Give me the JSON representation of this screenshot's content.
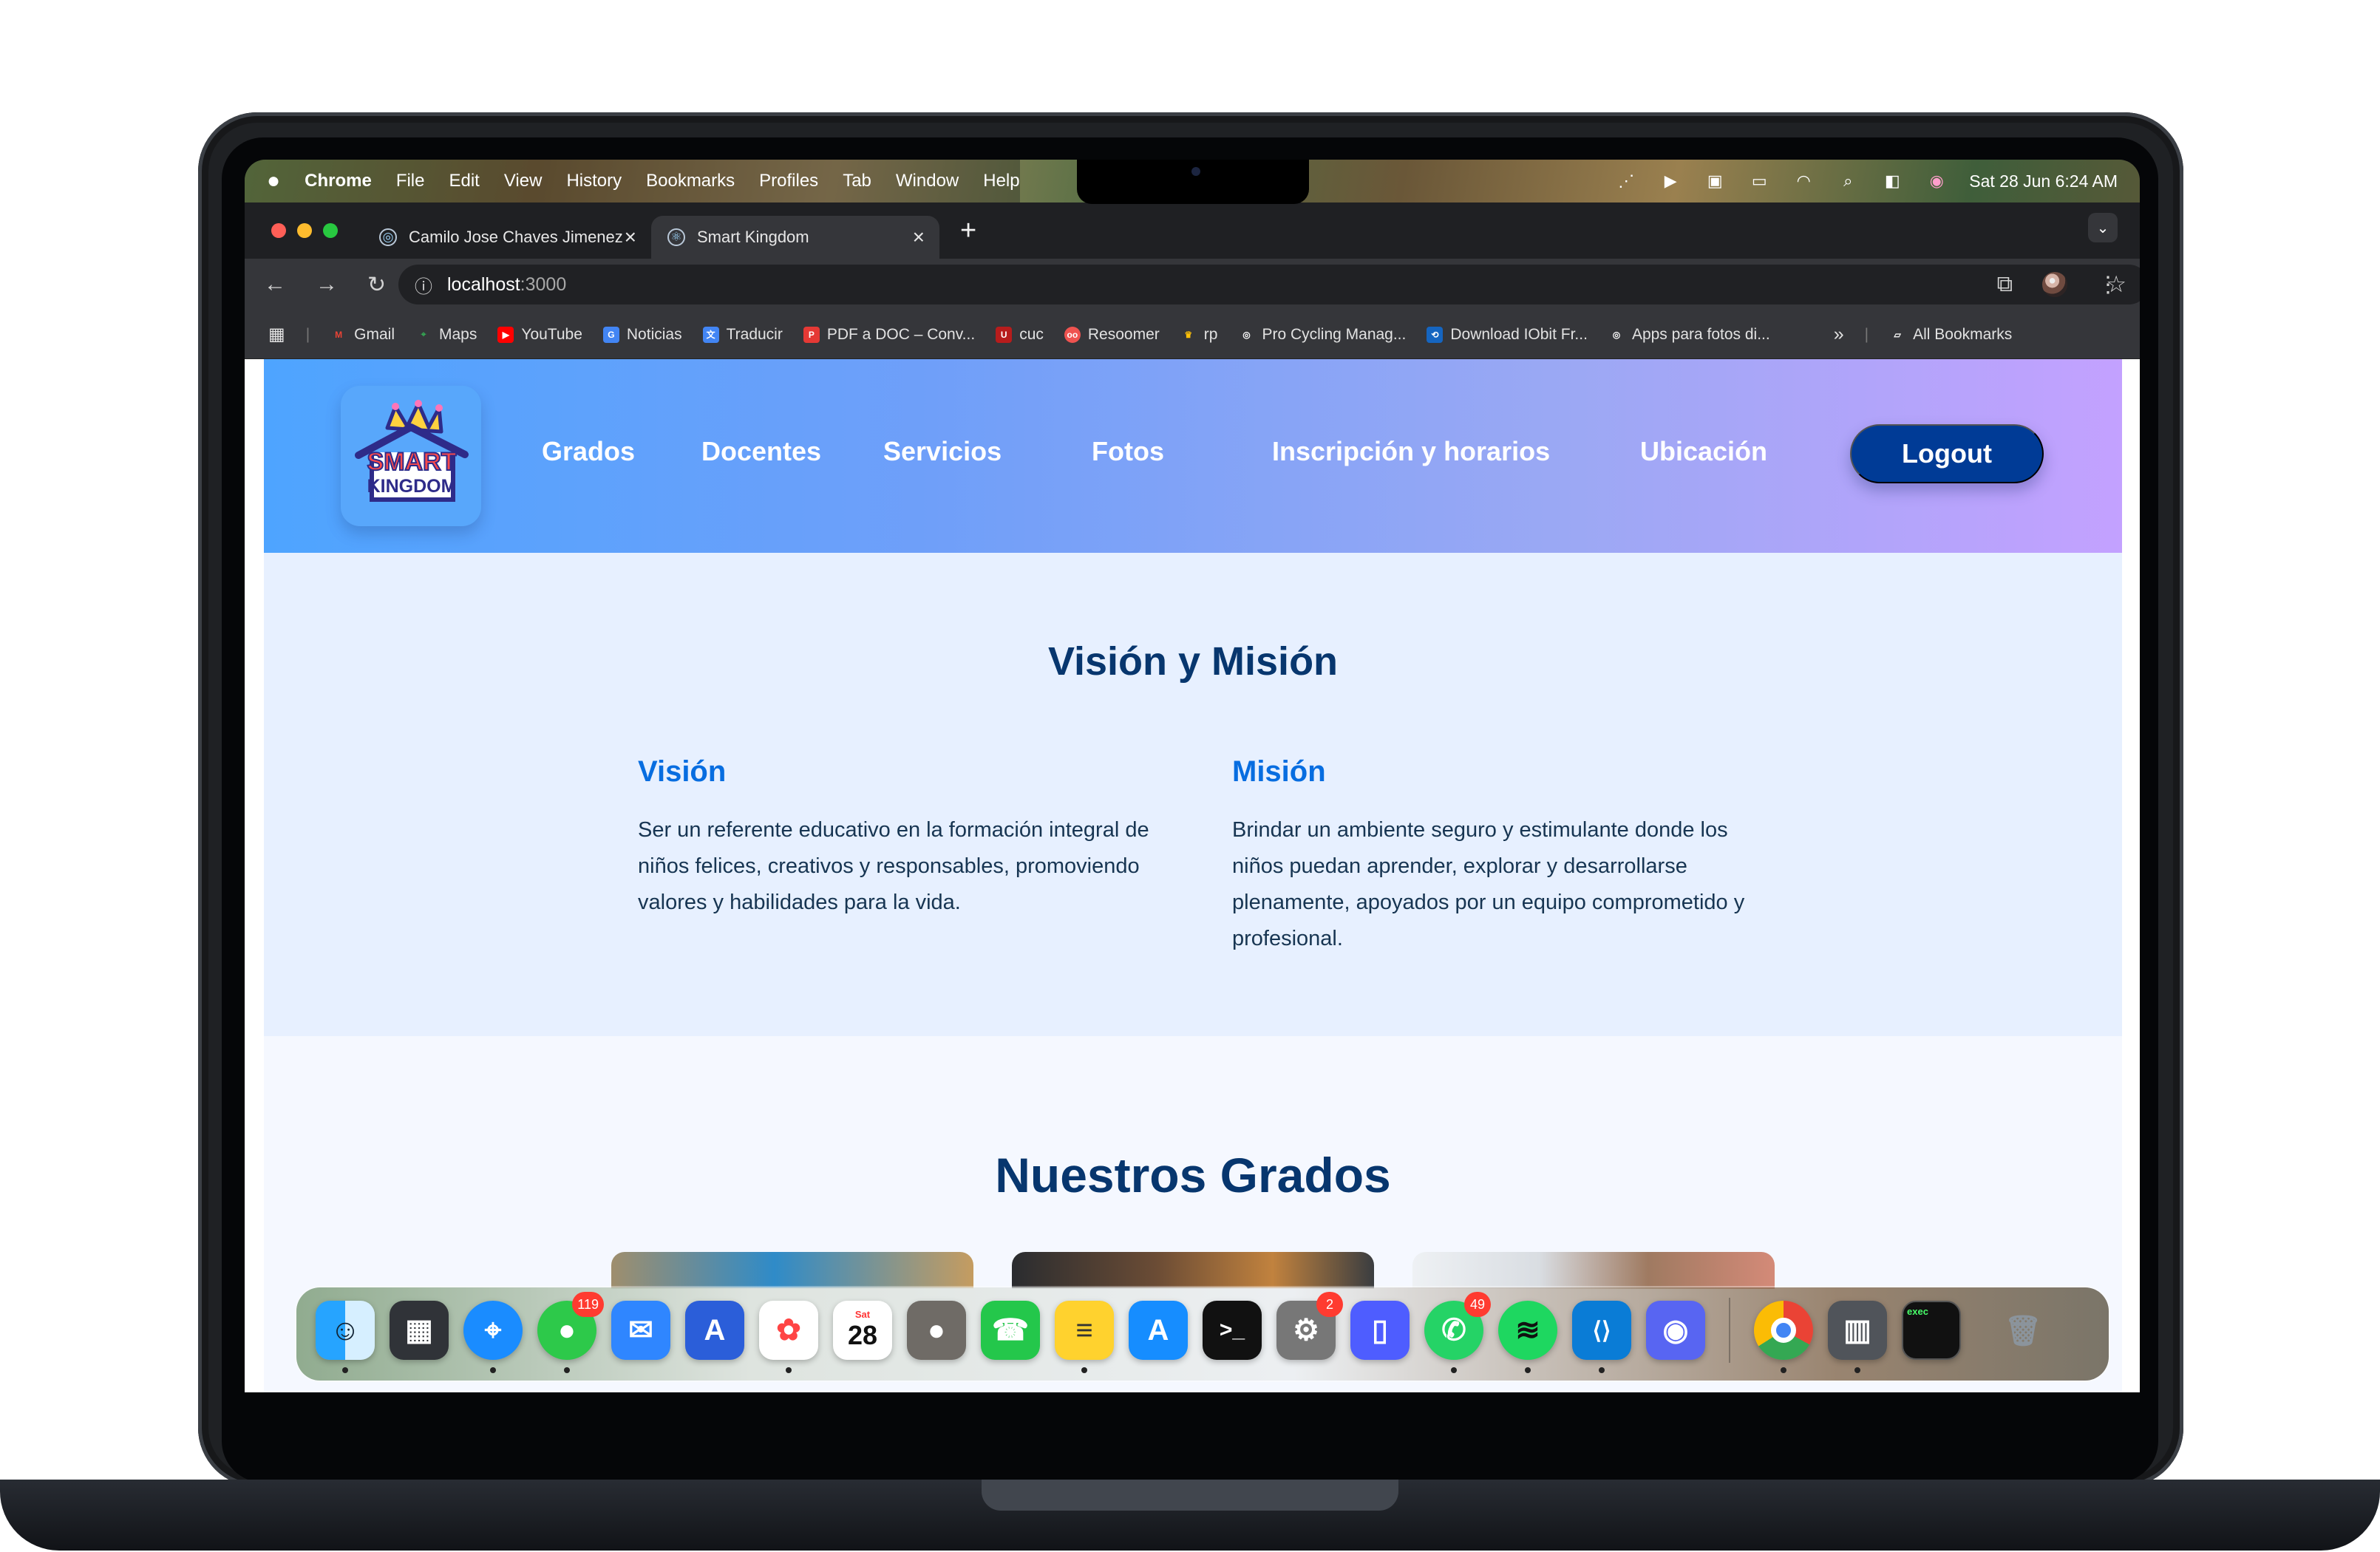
{
  "menu_bar": {
    "app": "Chrome",
    "items": [
      "File",
      "Edit",
      "View",
      "History",
      "Bookmarks",
      "Profiles",
      "Tab",
      "Window",
      "Help"
    ],
    "datetime": "Sat 28 Jun  6:24 AM",
    "icons": [
      "apple-icon",
      "screen-record-icon",
      "play-icon",
      "caption-icon",
      "battery-icon",
      "wifi-icon",
      "search-icon",
      "control-center-icon",
      "siri-icon"
    ]
  },
  "browser": {
    "tabs": [
      {
        "title": "Camilo Jose Chaves Jimenez",
        "active": false
      },
      {
        "title": "Smart Kingdom",
        "active": true
      }
    ],
    "new_tab": "+",
    "url_host": "localhost",
    "url_port": ":3000",
    "bookmarks": [
      "Gmail",
      "Maps",
      "YouTube",
      "Noticias",
      "Traducir",
      "PDF a DOC – Conv...",
      "cuc",
      "Resoomer",
      "rp",
      "Pro Cycling Manag...",
      "Download IObit Fr...",
      "Apps para fotos di..."
    ],
    "overflow": "»",
    "all_bookmarks": "All Bookmarks"
  },
  "site": {
    "logo_top": "SMART",
    "logo_bottom": "KINGDOM",
    "nav": [
      "Grados",
      "Docentes",
      "Servicios",
      "Fotos",
      "Inscripción y horarios",
      "Ubicación"
    ],
    "logout": "Logout",
    "vision_section_title": "Visión y Misión",
    "vision_title": "Visión",
    "vision_text": "Ser un referente educativo en la formación integral de niños felices, creativos y responsables, promoviendo valores y habilidades para la vida.",
    "mission_title": "Misión",
    "mission_text": "Brindar un ambiente seguro y estimulante donde los niños puedan aprender, explorar y desarrollarse plenamente, apoyados por un equipo comprometido y profesional.",
    "grades_title": "Nuestros Grados"
  },
  "dock": {
    "apps": [
      {
        "name": "Finder",
        "label": "☺",
        "color": "#1b8bff"
      },
      {
        "name": "Launchpad",
        "label": "▦",
        "color": "#303338"
      },
      {
        "name": "Safari",
        "label": "◎",
        "color": "#1a8cff"
      },
      {
        "name": "Messages",
        "label": "●",
        "color": "#2dc94a",
        "badge": "119"
      },
      {
        "name": "Mail",
        "label": "✉",
        "color": "#2f86ff"
      },
      {
        "name": "Xcode",
        "label": "A",
        "color": "#2b5ed9"
      },
      {
        "name": "Photos",
        "label": "✿",
        "color": "#fff"
      },
      {
        "name": "Calendar",
        "label": "28",
        "color": "#ffffff",
        "date_top": "Sat"
      },
      {
        "name": "Contacts",
        "label": "●",
        "color": "#6f6b66"
      },
      {
        "name": "Phone",
        "label": "☎",
        "color": "#24c74b"
      },
      {
        "name": "Notes",
        "label": "≡",
        "color": "#ffd22e"
      },
      {
        "name": "App Store",
        "label": "A",
        "color": "#168dff"
      },
      {
        "name": "Terminal",
        "label": ">_",
        "color": "#111"
      },
      {
        "name": "System Settings",
        "label": "⚙",
        "color": "#777",
        "badge": "2"
      },
      {
        "name": "Simulator",
        "label": "▯",
        "color": "#4e5dff"
      },
      {
        "name": "WhatsApp",
        "label": "✆",
        "color": "#25d366",
        "badge": "49"
      },
      {
        "name": "Spotify",
        "label": "≋",
        "color": "#1ed760"
      },
      {
        "name": "Visual Studio Code",
        "label": "⟨⟩",
        "color": "#0a7cd6"
      },
      {
        "name": "Discord",
        "label": "◉",
        "color": "#5865f2"
      },
      {
        "name": "Chrome",
        "label": "●",
        "color": "#ffffff"
      },
      {
        "name": "Server",
        "label": "▥",
        "color": "#50545a"
      },
      {
        "name": "Exec",
        "label": "exec",
        "color": "#111"
      },
      {
        "name": "Trash",
        "label": "🗑",
        "color": "#b7bdc2"
      }
    ]
  },
  "colors": {
    "header_start": "#4ea4ff",
    "header_end": "#c3a1ff",
    "navy": "#003b96",
    "title": "#07366e",
    "accent": "#076de0",
    "vision_bg": "#e7f0ff"
  }
}
